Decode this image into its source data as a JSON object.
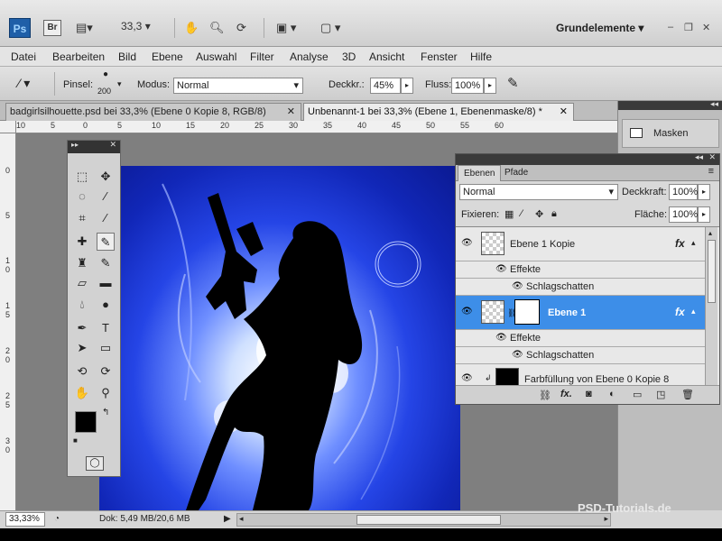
{
  "app": {
    "logo": "Ps",
    "bridge_logo": "Br",
    "zoom_value": "33,3",
    "workspace": "Grundelemente",
    "window_controls": [
      "–",
      "❐",
      "✕"
    ]
  },
  "menu": [
    "Datei",
    "Bearbeiten",
    "Bild",
    "Ebene",
    "Auswahl",
    "Filter",
    "Analyse",
    "3D",
    "Ansicht",
    "Fenster",
    "Hilfe"
  ],
  "options_bar": {
    "brush_label": "Pinsel:",
    "brush_size": "200",
    "mode_label": "Modus:",
    "mode_value": "Normal",
    "opacity_label": "Deckkr.:",
    "opacity_value": "45%",
    "flow_label": "Fluss:",
    "flow_value": "100%"
  },
  "tabs": [
    {
      "label": "badgirlsilhouette.psd bei 33,3% (Ebene 0 Kopie 8, RGB/8)",
      "close": "✕"
    },
    {
      "label": "Unbenannt-1 bei 33,3% (Ebene 1, Ebenenmaske/8) *",
      "close": "✕"
    }
  ],
  "ruler_h_ticks": [
    "10",
    "5",
    "0",
    "5",
    "10",
    "15",
    "20",
    "25",
    "30",
    "35",
    "40",
    "45",
    "50",
    "55",
    "60"
  ],
  "ruler_v_ticks": [
    "0",
    "5",
    "1 0",
    "1 5",
    "2 0",
    "2 5",
    "3 0"
  ],
  "masks_panel": {
    "label": "Masken"
  },
  "layers_panel": {
    "tabs": [
      "Ebenen",
      "Pfade"
    ],
    "blend_mode": "Normal",
    "opacity_label": "Deckkraft:",
    "opacity_value": "100%",
    "lock_label": "Fixieren:",
    "fill_label": "Fläche:",
    "fill_value": "100%",
    "layers": [
      {
        "name": "Ebene 1 Kopie",
        "fx": "fx",
        "effects_label": "Effekte",
        "effect": "Schlagschatten"
      },
      {
        "name": "Ebene 1",
        "fx": "fx",
        "effects_label": "Effekte",
        "effect": "Schlagschatten",
        "selected": true
      },
      {
        "name": "Farbfüllung von Ebene 0 Kopie 8"
      }
    ],
    "footer_fx": "fx."
  },
  "status": {
    "zoom": "33,33%",
    "doc": "Dok: 5,49 MB/20,6 MB"
  },
  "watermark": "PSD-Tutorials.de",
  "colors": {
    "selection_blue": "#3d8ee8",
    "canvas_bg": "#7f7f7f",
    "image_blue": "#1a35d6"
  }
}
